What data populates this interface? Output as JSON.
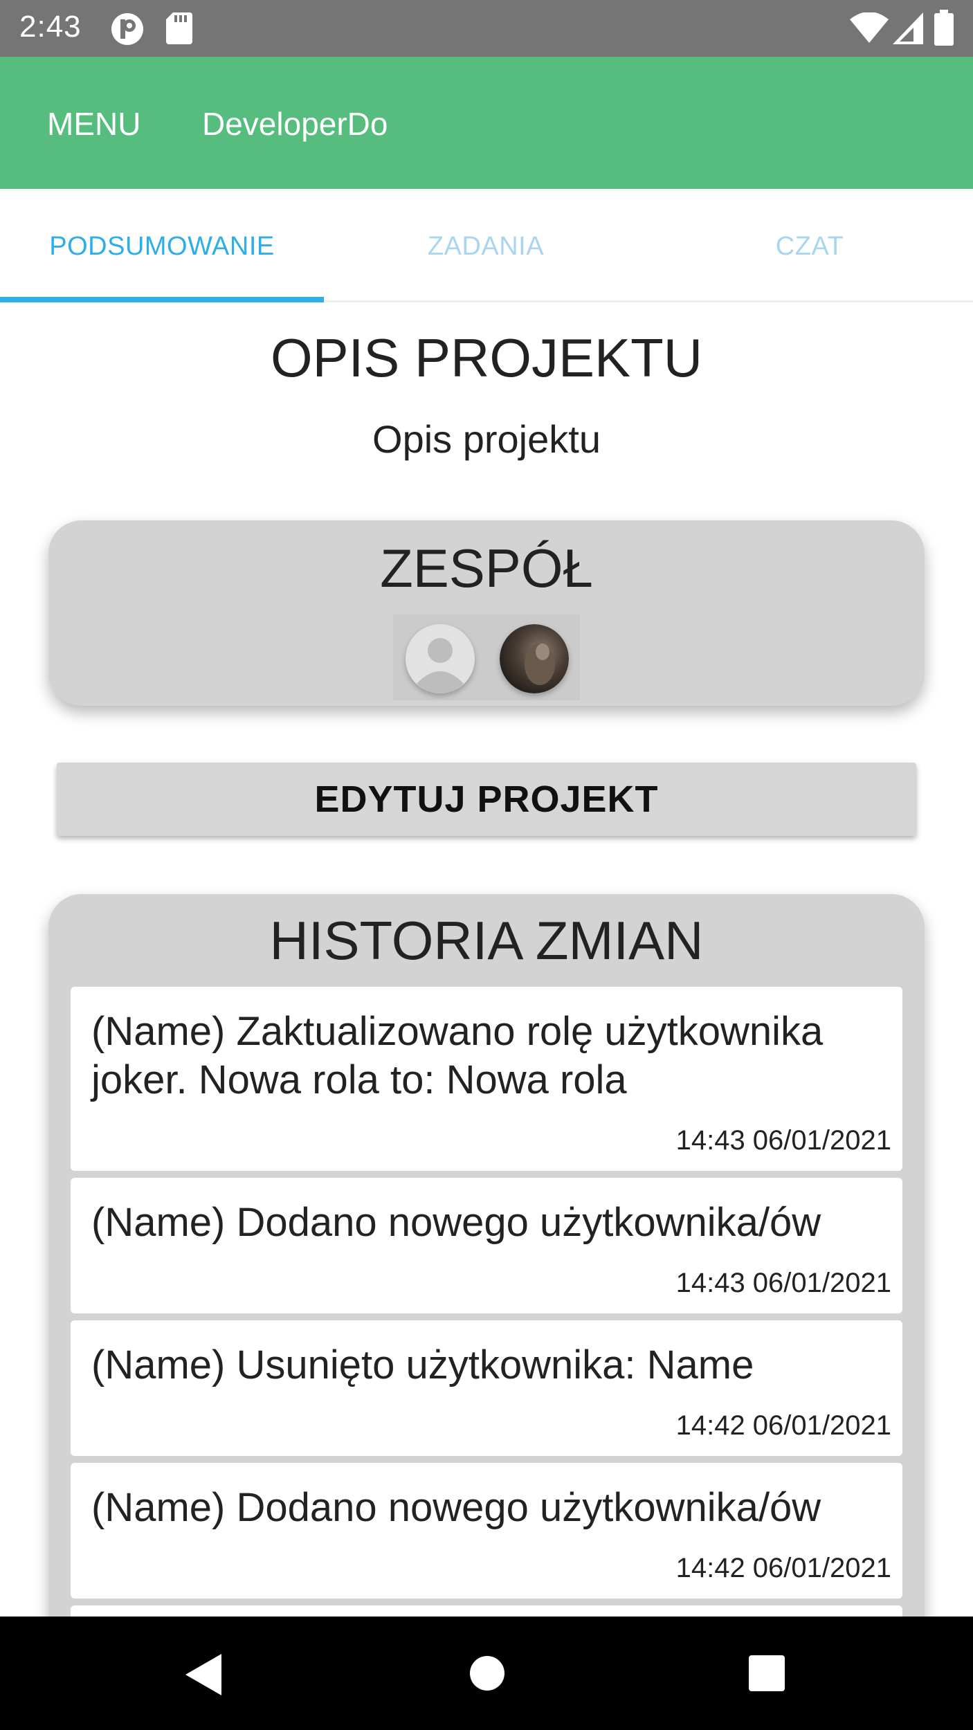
{
  "status_bar": {
    "time": "2:43",
    "left_icons": [
      "p-badge-icon",
      "sd-card-icon"
    ],
    "right_icons": [
      "wifi-icon",
      "cell-signal-icon",
      "battery-icon"
    ]
  },
  "app_bar": {
    "menu_label": "MENU",
    "title": "DeveloperDo",
    "color": "#57bd7f"
  },
  "tabs": [
    {
      "label": "PODSUMOWANIE",
      "active": true
    },
    {
      "label": "ZADANIA",
      "active": false
    },
    {
      "label": "CZAT",
      "active": false
    }
  ],
  "project": {
    "heading": "OPIS PROJEKTU",
    "description": "Opis projektu"
  },
  "team": {
    "title": "ZESPÓŁ",
    "members": [
      {
        "avatar": "default-avatar-icon"
      },
      {
        "avatar": "photo-avatar"
      }
    ]
  },
  "edit_button": {
    "label": "EDYTUJ PROJEKT"
  },
  "history": {
    "title": "HISTORIA ZMIAN",
    "items": [
      {
        "message": "(Name) Zaktualizowano rolę użytkownika joker. Nowa rola to: Nowa rola",
        "timestamp": "14:43 06/01/2021"
      },
      {
        "message": "(Name) Dodano nowego użytkownika/ów",
        "timestamp": "14:43 06/01/2021"
      },
      {
        "message": "(Name) Usunięto użytkownika: Name",
        "timestamp": "14:42 06/01/2021"
      },
      {
        "message": "(Name) Dodano nowego użytkownika/ów",
        "timestamp": "14:42 06/01/2021"
      }
    ]
  },
  "nav_bar": {
    "buttons": [
      "back-icon",
      "home-icon",
      "recents-icon"
    ]
  },
  "colors": {
    "accent": "#2eaee8",
    "tab_inactive": "#a9d5ee",
    "card": "#d3d3d3"
  }
}
